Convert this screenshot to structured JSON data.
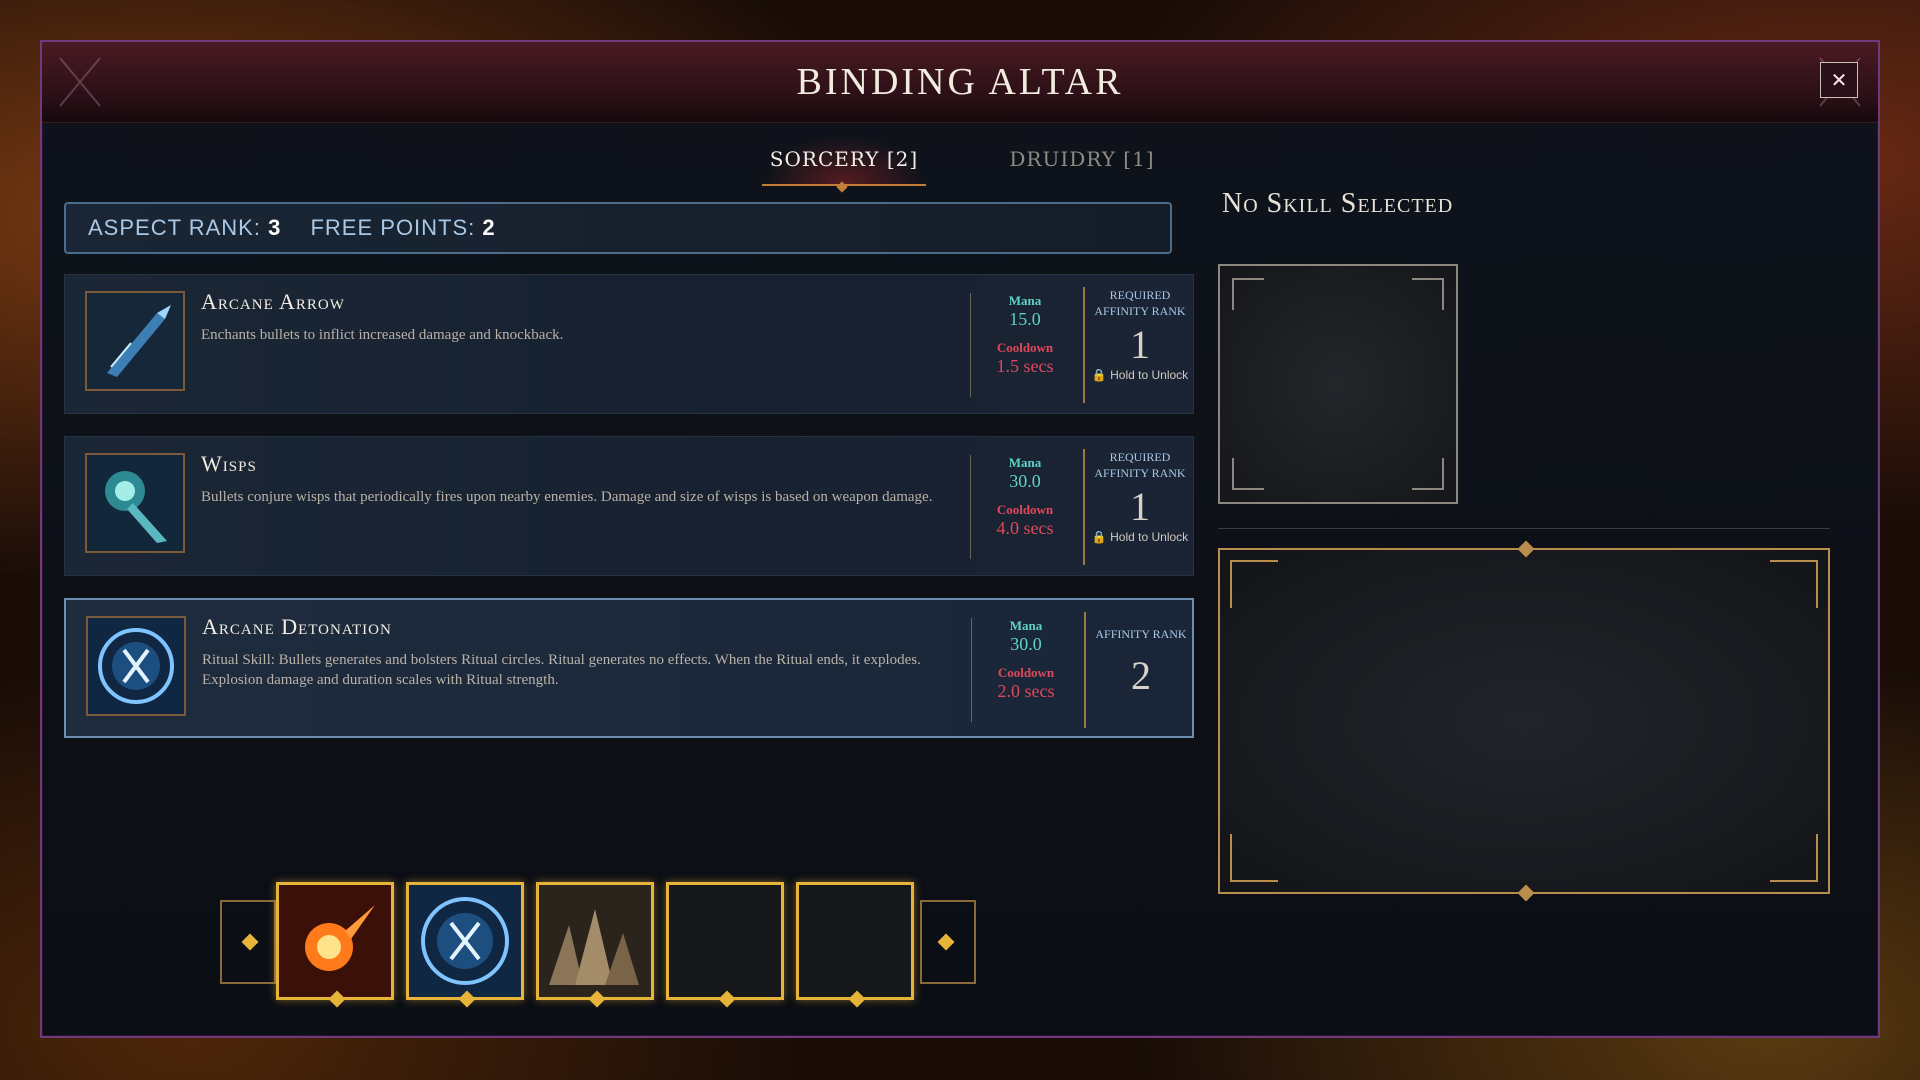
{
  "window": {
    "title": "BINDING ALTAR",
    "close_label": "✕"
  },
  "tabs": [
    {
      "label": "SORCERY [2]",
      "active": true
    },
    {
      "label": "DRUIDRY [1]",
      "active": false
    }
  ],
  "rank_bar": {
    "aspect_rank_label": "ASPECT RANK:",
    "aspect_rank_value": "3",
    "free_points_label": "FREE POINTS:",
    "free_points_value": "2"
  },
  "skills": [
    {
      "name": "Arcane Arrow",
      "description": "Enchants bullets to inflict increased damage and knockback.",
      "mana_label": "Mana",
      "mana": "15.0",
      "cooldown_label": "Cooldown",
      "cooldown": "1.5 secs",
      "affinity_label": "REQUIRED AFFINITY RANK",
      "affinity": "1",
      "hold_label": "Hold to Unlock",
      "icon": "arcane-arrow-icon"
    },
    {
      "name": "Wisps",
      "description": "Bullets conjure wisps that periodically fires upon nearby enemies. Damage and size of wisps is based on weapon damage.",
      "mana_label": "Mana",
      "mana": "30.0",
      "cooldown_label": "Cooldown",
      "cooldown": "4.0 secs",
      "affinity_label": "REQUIRED AFFINITY RANK",
      "affinity": "1",
      "hold_label": "Hold to Unlock",
      "icon": "wisps-icon"
    },
    {
      "name": "Arcane Detonation",
      "description": "Ritual Skill: Bullets generates and bolsters Ritual circles. Ritual generates no effects. When the Ritual ends, it explodes. Explosion damage and duration scales with Ritual strength.",
      "mana_label": "Mana",
      "mana": "30.0",
      "cooldown_label": "Cooldown",
      "cooldown": "2.0 secs",
      "affinity_label": "AFFINITY RANK",
      "affinity": "2",
      "icon": "arcane-detonation-icon"
    }
  ],
  "detail_panel": {
    "title": "No Skill Selected"
  },
  "hotbar": {
    "slots": [
      "fireball-icon",
      "arcane-detonation-icon",
      "earth-spikes-icon",
      "empty",
      "empty"
    ]
  },
  "colors": {
    "accent_gold": "#e7b43a",
    "mana": "#5fd3c8",
    "cooldown": "#e0485a",
    "frame_purple": "#6f3a7c"
  }
}
